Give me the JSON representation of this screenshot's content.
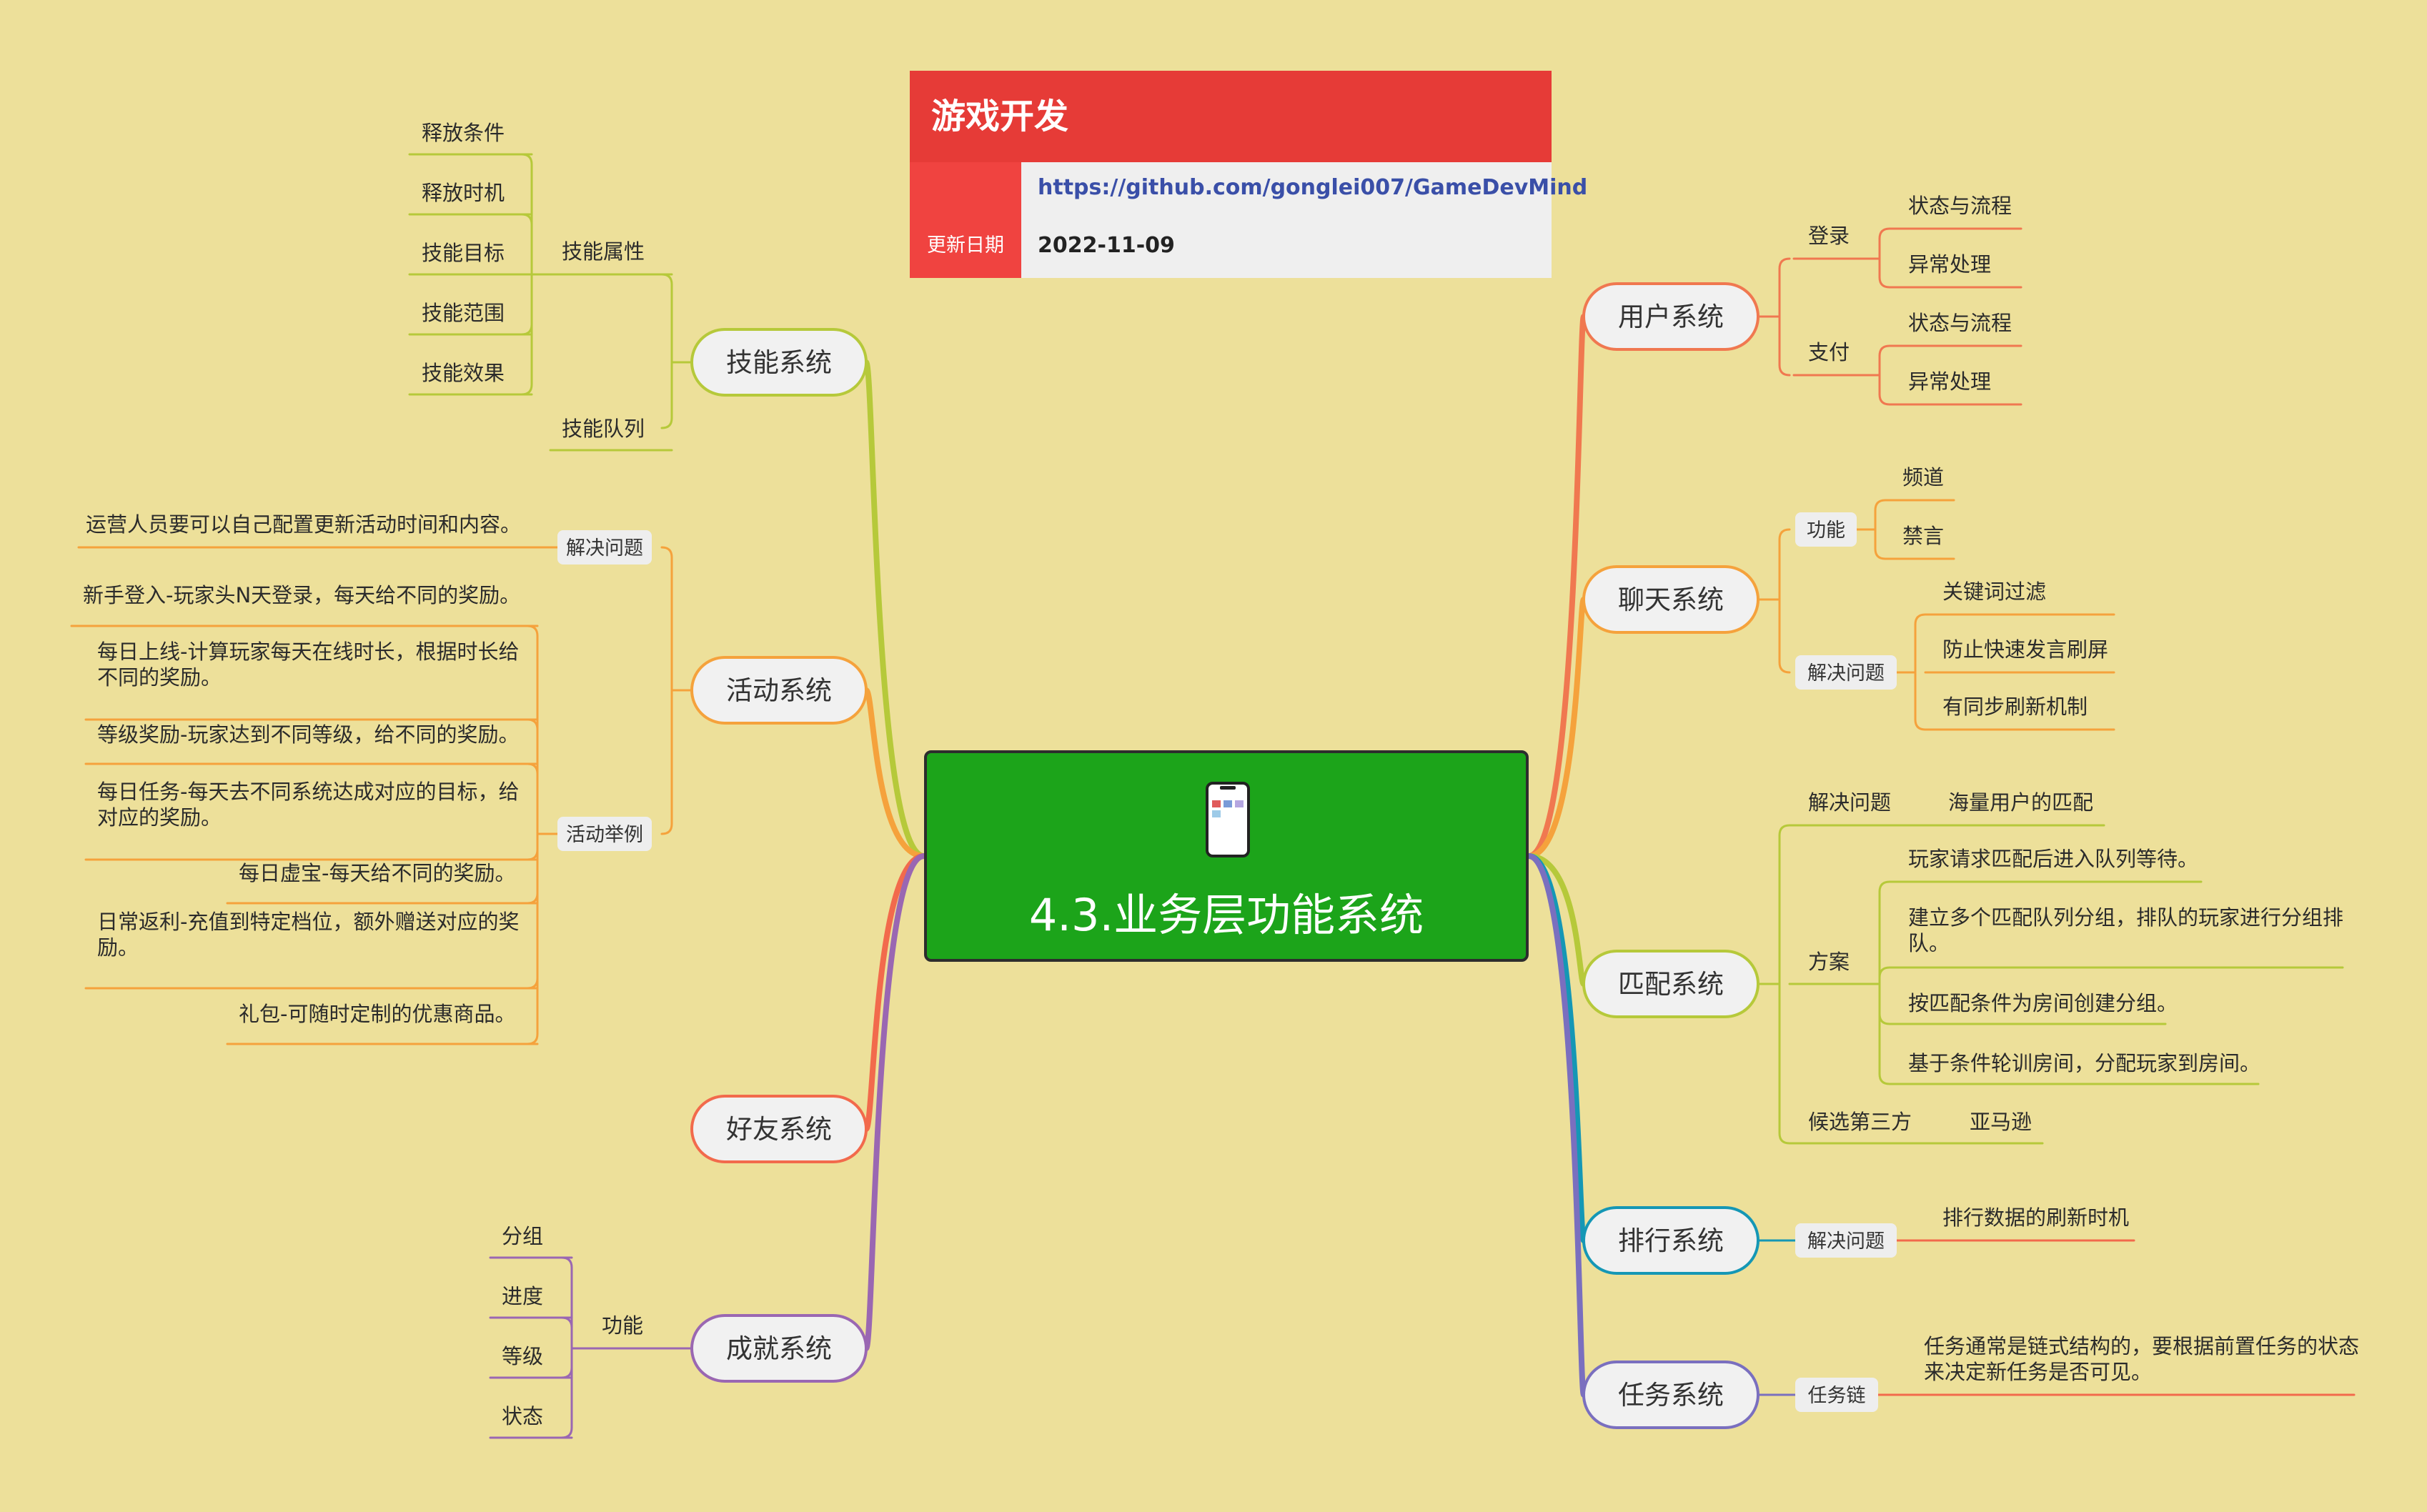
{
  "card": {
    "title": "游戏开发",
    "url": "https://github.com/gonglei007/GameDevMind",
    "date_label": "更新日期",
    "date": "2022-11-09"
  },
  "center": {
    "title": "4.3.业务层功能系统",
    "icon": "mobile-phone-icon"
  },
  "colors": {
    "background": "#ede09a",
    "center_fill": "#1ca41a",
    "card_red": "#e63b37",
    "skill": "#b6c93a",
    "activity": "#f5a23c",
    "friend": "#f26a4c",
    "achievement": "#9a67b2",
    "user": "#f07850",
    "chat": "#f5a23c",
    "match": "#b6c93a",
    "rank": "#1597b5",
    "task": "#7a6fbf"
  },
  "branches": {
    "skill": {
      "label": "技能系统",
      "attr_label": "技能属性",
      "attrs": [
        "释放条件",
        "释放时机",
        "技能目标",
        "技能范围",
        "技能效果"
      ],
      "queue_label": "技能队列"
    },
    "activity": {
      "label": "活动系统",
      "problem_label": "解决问题",
      "problem": "运营人员要可以自己配置更新活动时间和内容。",
      "examples_label": "活动举例",
      "examples": [
        [
          "新手登入-玩家头N天登录，每天给不同的奖励。"
        ],
        [
          "每日上线-计算玩家每天在线时长，根据时长给",
          "不同的奖励。"
        ],
        [
          "等级奖励-玩家达到不同等级，给不同的奖励。"
        ],
        [
          "每日任务-每天去不同系统达成对应的目标，给",
          "对应的奖励。"
        ],
        [
          "每日虚宝-每天给不同的奖励。"
        ],
        [
          "日常返利-充值到特定档位，额外赠送对应的奖",
          "励。"
        ],
        [
          "礼包-可随时定制的优惠商品。"
        ]
      ]
    },
    "friend": {
      "label": "好友系统"
    },
    "achievement": {
      "label": "成就系统",
      "func_label": "功能",
      "items": [
        "分组",
        "进度",
        "等级",
        "状态"
      ]
    },
    "user": {
      "label": "用户系统",
      "login_label": "登录",
      "login_items": [
        "状态与流程",
        "异常处理"
      ],
      "pay_label": "支付",
      "pay_items": [
        "状态与流程",
        "异常处理"
      ]
    },
    "chat": {
      "label": "聊天系统",
      "func_label": "功能",
      "func_items": [
        "频道",
        "禁言"
      ],
      "problem_label": "解决问题",
      "problem_items": [
        "关键词过滤",
        "防止快速发言刷屏",
        "有同步刷新机制"
      ]
    },
    "match": {
      "label": "匹配系统",
      "problem_label": "解决问题",
      "problem": "海量用户的匹配",
      "plan_label": "方案",
      "plans": [
        [
          "玩家请求匹配后进入队列等待。"
        ],
        [
          "建立多个匹配队列分组，排队的玩家进行分组排",
          "队。"
        ],
        [
          "按匹配条件为房间创建分组。"
        ],
        [
          "基于条件轮训房间，分配玩家到房间。"
        ]
      ],
      "third_label": "候选第三方",
      "third": "亚马逊"
    },
    "rank": {
      "label": "排行系统",
      "problem_label": "解决问题",
      "problem": "排行数据的刷新时机"
    },
    "task": {
      "label": "任务系统",
      "chain_label": "任务链",
      "chain": [
        "任务通常是链式结构的，要根据前置任务的状态",
        "来决定新任务是否可见。"
      ]
    }
  }
}
